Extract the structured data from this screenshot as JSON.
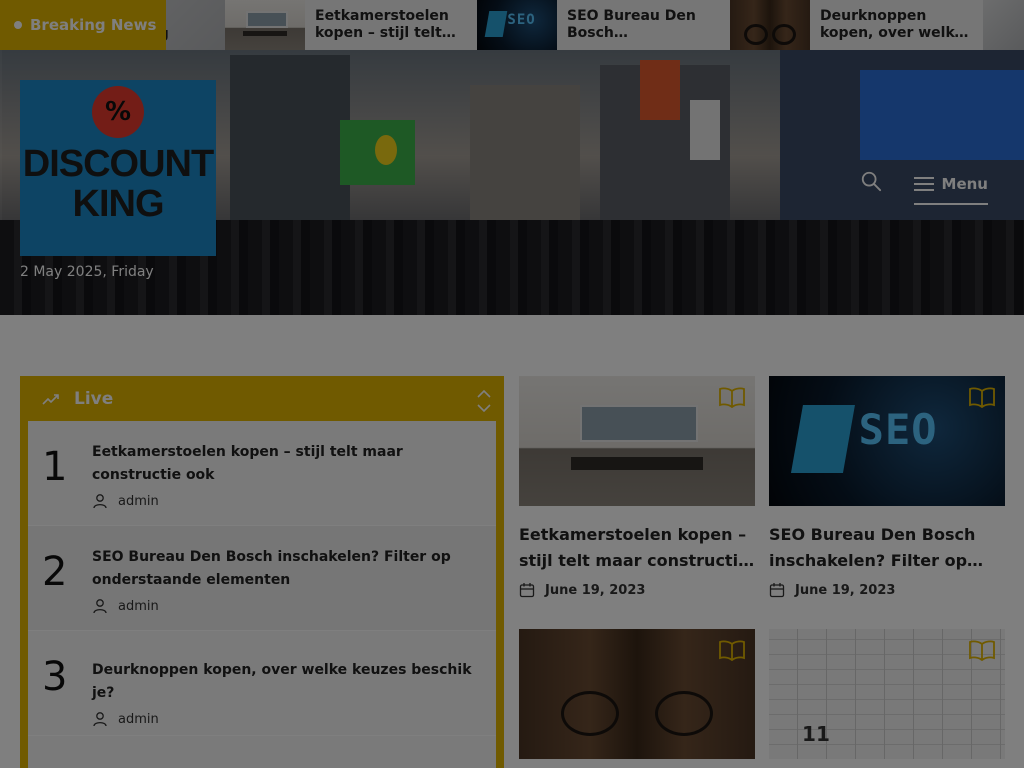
{
  "ticker": {
    "badge": "Breaking News",
    "partial_title": "…ding",
    "items": [
      {
        "title": "Eetkamerstoelen kopen – stijl telt maar constructie ook",
        "thumb": "room"
      },
      {
        "title": "SEO Bureau Den Bosch inschakelen? Filter op onderstaande elementen",
        "thumb": "seo"
      },
      {
        "title": "Deurknoppen kopen, over welke keuzes beschik je?",
        "thumb": "door"
      }
    ]
  },
  "header": {
    "logo_badge": "%",
    "logo_name_line1": "DISCOUNT",
    "logo_name_line2": "KING",
    "date": "2 May 2025, Friday",
    "menu_label": "Menu"
  },
  "live": {
    "title": "Live",
    "items": [
      {
        "rank": "1",
        "title": "Eetkamerstoelen kopen – stijl telt maar constructie ook",
        "author": "admin"
      },
      {
        "rank": "2",
        "title": "SEO Bureau Den Bosch inschakelen? Filter op onderstaande elementen",
        "author": "admin"
      },
      {
        "rank": "3",
        "title": "Deurknoppen kopen, over welke keuzes beschik je?",
        "author": "admin"
      }
    ]
  },
  "cards": [
    {
      "title": "Eetkamerstoelen kopen – stijl telt maar constructie ook",
      "date": "June 19, 2023",
      "thumb": "room"
    },
    {
      "title": "SEO Bureau Den Bosch inschakelen? Filter op onderstaande elementen",
      "date": "June 19, 2023",
      "thumb": "seo"
    },
    {
      "title": "",
      "date": "",
      "thumb": "door"
    },
    {
      "title": "",
      "date": "",
      "thumb": "calendar"
    }
  ],
  "colors": {
    "accent": "#e0b400",
    "logo_bg": "#1b88c8",
    "logo_badge": "#e63b2e"
  },
  "thumb_text": {
    "seo": "SEO",
    "calendar_num": "11"
  }
}
